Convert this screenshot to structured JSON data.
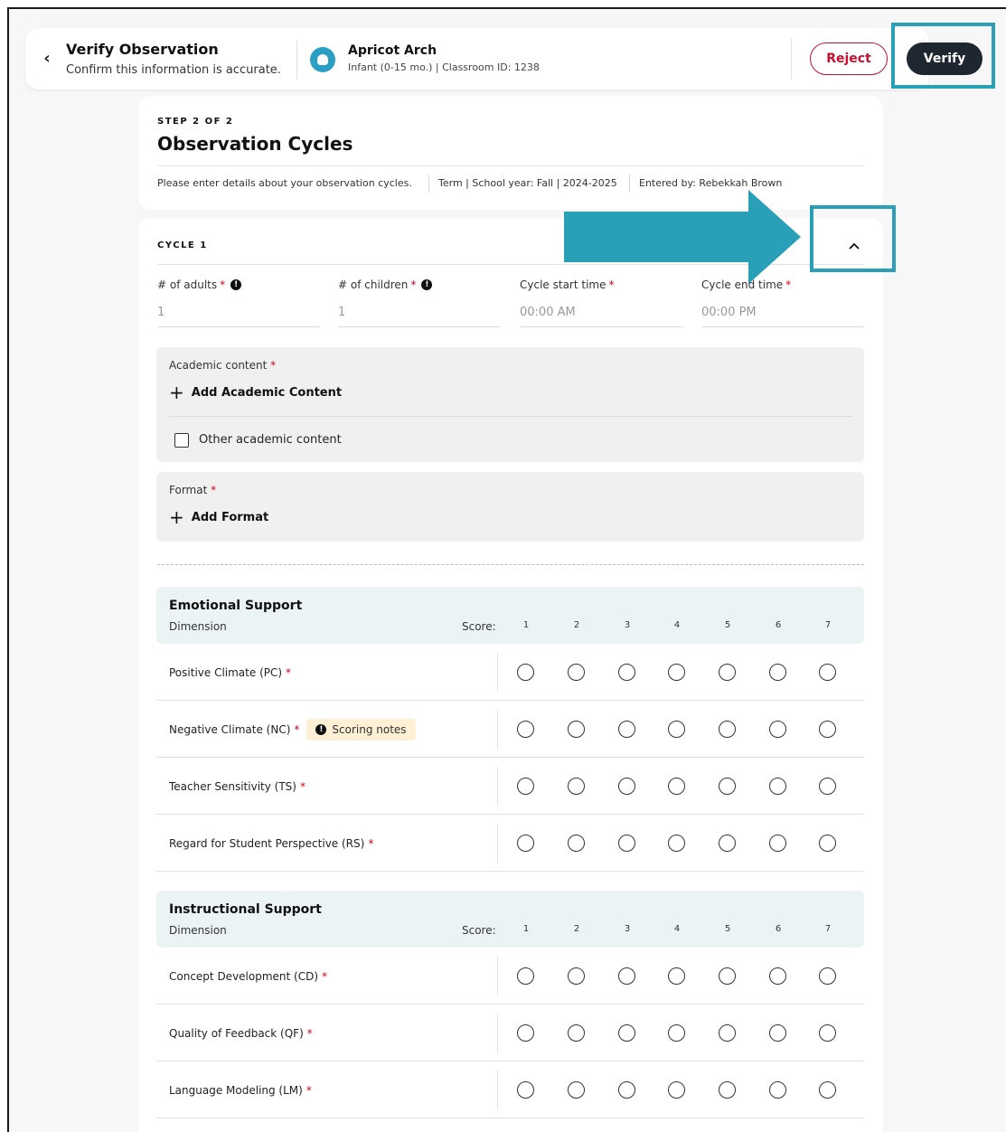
{
  "header": {
    "title": "Verify Observation",
    "subtitle": "Confirm this information is accurate.",
    "classroom_name": "Apricot Arch",
    "classroom_info": "Infant (0-15 mo.) | Classroom ID: 1238",
    "reject_label": "Reject",
    "verify_label": "Verify"
  },
  "step": {
    "label": "STEP 2 OF 2",
    "title": "Observation Cycles",
    "meta": [
      "Please enter details about your observation cycles.",
      "Term | School year: Fall | 2024-2025",
      "Entered by: Rebekkah Brown"
    ]
  },
  "cycle": {
    "label": "CYCLE 1",
    "fields": [
      {
        "label": "# of adults",
        "value": "1"
      },
      {
        "label": "# of children",
        "value": "1"
      },
      {
        "label": "Cycle start time",
        "value": "00:00 AM"
      },
      {
        "label": "Cycle end time",
        "value": "00:00 PM"
      }
    ],
    "academic": {
      "label": "Academic content",
      "add": "Add Academic Content",
      "other": "Other academic content"
    },
    "format": {
      "label": "Format",
      "add": "Add Format"
    }
  },
  "required_mark": "*",
  "sections": [
    {
      "title": "Emotional Support",
      "dimension_label": "Dimension",
      "score_label": "Score:",
      "scores": [
        "1",
        "2",
        "3",
        "4",
        "5",
        "6",
        "7"
      ],
      "rows": [
        {
          "label": "Positive Climate (PC)"
        },
        {
          "label": "Negative Climate (NC)",
          "note": "Scoring notes"
        },
        {
          "label": "Teacher Sensitivity (TS)"
        },
        {
          "label": "Regard for Student Perspective (RS)"
        }
      ]
    },
    {
      "title": "Instructional Support",
      "dimension_label": "Dimension",
      "score_label": "Score:",
      "scores": [
        "1",
        "2",
        "3",
        "4",
        "5",
        "6",
        "7"
      ],
      "rows": [
        {
          "label": "Concept Development (CD)"
        },
        {
          "label": "Quality of Feedback (QF)"
        },
        {
          "label": "Language Modeling (LM)"
        }
      ]
    }
  ],
  "colors": {
    "highlight": "#2aa0b8",
    "reject": "#c8102e",
    "verify_bg": "#1e2630",
    "section_bg": "#ecf3f5",
    "note_bg": "#fdf0d5"
  }
}
